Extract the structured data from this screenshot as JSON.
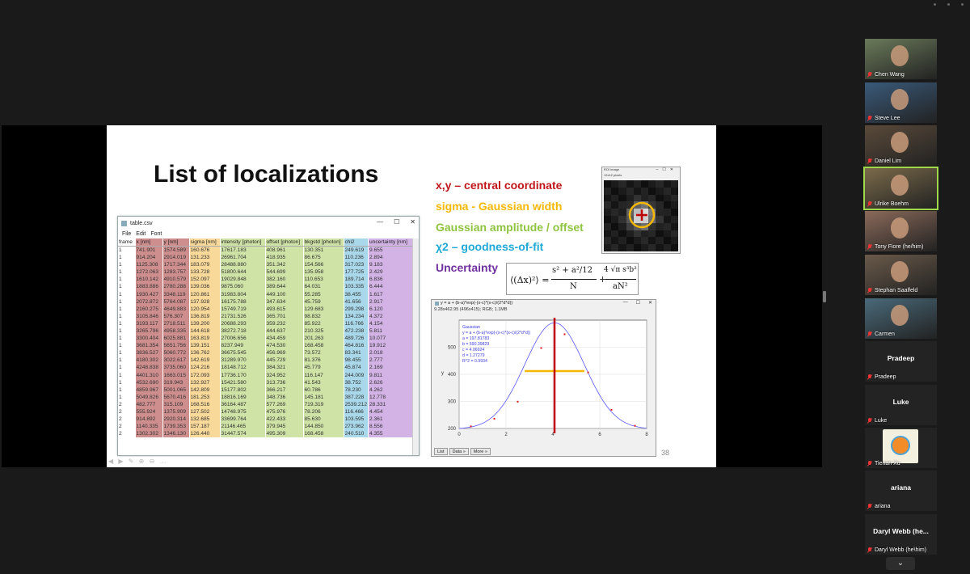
{
  "slide": {
    "title": "List of localizations",
    "legend": [
      {
        "text": "x,y – central coordinate",
        "color": "#c0161b"
      },
      {
        "text": "sigma - Gaussian width",
        "color": "#f5b800"
      },
      {
        "text": "Gaussian amplitude / offset",
        "color": "#8fc440"
      },
      {
        "text": "χ2 – goodness-of-fit",
        "color": "#1fa9d6"
      },
      {
        "text": "Uncertainty",
        "color": "#7030a0"
      }
    ],
    "formula": {
      "lhs": "⟨(Δx)²⟩ =",
      "frac1_num": "s² + a²/12",
      "frac1_den": "N",
      "plus": "+",
      "frac2_num": "4 √π s³b²",
      "frac2_den": "aN²"
    },
    "slide_number": "38"
  },
  "table_window": {
    "title": "table.csv",
    "menu": [
      "File",
      "Edit",
      "Font"
    ],
    "columns": [
      {
        "label": "frame",
        "color": "#ffffff"
      },
      {
        "label": "x [nm]",
        "color": "#ce8e8e"
      },
      {
        "label": "y [nm]",
        "color": "#ce8e8e"
      },
      {
        "label": "sigma [nm]",
        "color": "#f8d99a"
      },
      {
        "label": "intensity [photon]",
        "color": "#cfe3a6"
      },
      {
        "label": "offset [photon]",
        "color": "#cfe3a6"
      },
      {
        "label": "bkgstd [photon]",
        "color": "#cfe3a6"
      },
      {
        "label": "chi2",
        "color": "#a8d8ea"
      },
      {
        "label": "uncertainty [nm]",
        "color": "#d3b2e6"
      }
    ],
    "rows": [
      [
        "1",
        "741.901",
        "1574.589",
        "160.676",
        "17617.183",
        "408.961",
        "130.351",
        "249.619",
        "9.655"
      ],
      [
        "1",
        "914.204",
        "2914.019",
        "131.233",
        "26961.704",
        "418.935",
        "86.675",
        "110.236",
        "2.894"
      ],
      [
        "1",
        "1125.308",
        "1717.344",
        "183.079",
        "28488.880",
        "351.342",
        "154.566",
        "317.023",
        "9.183"
      ],
      [
        "1",
        "1272.063",
        "1283.757",
        "133.728",
        "51800.644",
        "544.699",
        "135.958",
        "177.725",
        "2.429"
      ],
      [
        "1",
        "1610.142",
        "4910.579",
        "152.097",
        "19029.848",
        "382.160",
        "110.653",
        "189.714",
        "6.836"
      ],
      [
        "1",
        "1883.886",
        "2780.288",
        "139.036",
        "9875.060",
        "389.644",
        "64.031",
        "103.335",
        "6.444"
      ],
      [
        "1",
        "1930.427",
        "3348.119",
        "120.861",
        "31983.804",
        "449.100",
        "55.285",
        "38.455",
        "1.617"
      ],
      [
        "1",
        "2072.872",
        "5764.087",
        "137.928",
        "16175.788",
        "347.634",
        "45.759",
        "41.656",
        "2.917"
      ],
      [
        "1",
        "2160.275",
        "4649.883",
        "120.954",
        "15749.719",
        "493.615",
        "129.683",
        "299.298",
        "6.120"
      ],
      [
        "1",
        "3105.846",
        "576.307",
        "136.819",
        "21731.526",
        "365.701",
        "98.832",
        "134.234",
        "4.372"
      ],
      [
        "1",
        "3193.117",
        "2718.511",
        "139.200",
        "20688.293",
        "359.232",
        "85.922",
        "116.766",
        "4.154"
      ],
      [
        "1",
        "3265.796",
        "4958.335",
        "144.618",
        "38272.718",
        "444.637",
        "210.325",
        "472.238",
        "5.811"
      ],
      [
        "1",
        "3300.404",
        "6025.881",
        "163.819",
        "27006.656",
        "434.459",
        "201.263",
        "489.726",
        "10.077"
      ],
      [
        "1",
        "3681.354",
        "5651.756",
        "139.151",
        "8237.949",
        "474.530",
        "168.458",
        "464.816",
        "19.912"
      ],
      [
        "1",
        "3836.527",
        "5060.772",
        "136.762",
        "36675.545",
        "456.969",
        "73.572",
        "83.341",
        "2.018"
      ],
      [
        "1",
        "4180.302",
        "3022.617",
        "142.619",
        "31289.970",
        "445.729",
        "81.376",
        "98.455",
        "2.777"
      ],
      [
        "1",
        "4248.838",
        "3735.060",
        "124.216",
        "18148.712",
        "384.321",
        "45.779",
        "45.874",
        "2.169"
      ],
      [
        "1",
        "4401.310",
        "1663.015",
        "172.093",
        "17736.170",
        "324.952",
        "116.147",
        "244.009",
        "9.811"
      ],
      [
        "1",
        "4532.690",
        "319.943",
        "132.927",
        "15421.580",
        "313.736",
        "41.543",
        "38.752",
        "2.626"
      ],
      [
        "1",
        "4859.967",
        "5001.065",
        "142.809",
        "15177.802",
        "366.217",
        "60.786",
        "78.230",
        "4.262"
      ],
      [
        "1",
        "5049.826",
        "5670.416",
        "181.253",
        "18816.169",
        "348.736",
        "145.181",
        "387.228",
        "12.778"
      ],
      [
        "2",
        "482.777",
        "315.109",
        "168.516",
        "36164.487",
        "577.269",
        "719.319",
        "2539.212",
        "28.331"
      ],
      [
        "2",
        "555.924",
        "1375.909",
        "127.502",
        "14748.975",
        "475.976",
        "78.206",
        "116.466",
        "4.454"
      ],
      [
        "2",
        "914.892",
        "2920.314",
        "132.685",
        "33699.764",
        "422.433",
        "85.630",
        "103.595",
        "2.361"
      ],
      [
        "2",
        "1140.335",
        "1739.353",
        "157.187",
        "21146.465",
        "379.945",
        "144.850",
        "273.962",
        "8.556"
      ],
      [
        "2",
        "1302.302",
        "1346.130",
        "126.440",
        "31447.574",
        "495.309",
        "168.458",
        "240.510",
        "4.355"
      ]
    ]
  },
  "roi_window": {
    "title": "ROI image",
    "subtitle": "12x12 pixels"
  },
  "plot_window": {
    "title": "y = a + (b-a)*exp(-(x-c)*(x-c)/(2*d*d))",
    "info": "9.28x462.95  (496x415); RGB; 1.1MB",
    "legend_lines": [
      "Gaussian",
      "y = a + (b-a)*exp(-(x-c)*(x-c)/(2*d*d))",
      "a = 197.81783",
      "b = 590.39829",
      "c = 4.06924",
      "d = 1.27279",
      "R^2 = 0.9934"
    ],
    "buttons": [
      "List",
      "Data »",
      "More »"
    ],
    "chart_data": {
      "type": "scatter",
      "title": "y = a + (b-a)*exp(-(x-c)*(x-c)/(2*d*d))",
      "xlabel": "",
      "ylabel": "y",
      "xlim": [
        0,
        8
      ],
      "ylim": [
        200,
        600
      ],
      "x_ticks": [
        0,
        2,
        4,
        6,
        8
      ],
      "y_ticks": [
        200,
        300,
        400,
        500
      ],
      "points": [
        {
          "x": 0.5,
          "y": 208
        },
        {
          "x": 1.5,
          "y": 236
        },
        {
          "x": 2.5,
          "y": 299
        },
        {
          "x": 3.5,
          "y": 497
        },
        {
          "x": 4.5,
          "y": 548
        },
        {
          "x": 5.5,
          "y": 407
        },
        {
          "x": 6.5,
          "y": 269
        },
        {
          "x": 7.5,
          "y": 210
        }
      ],
      "fit": {
        "a": 197.81783,
        "b": 590.39829,
        "c": 4.06924,
        "d": 1.27279
      },
      "colors": {
        "points": "#e01818",
        "fit": "#5a5aff",
        "center_line": "#c00000",
        "width_line": "#f5b800"
      }
    }
  },
  "participants": [
    {
      "name": "Chen Wang",
      "type": "video",
      "bg": "#6a7a5a"
    },
    {
      "name": "Steve Lee",
      "type": "video",
      "bg": "#3a5a7a"
    },
    {
      "name": "Daniel Lim",
      "type": "video",
      "bg": "#5a4a3a"
    },
    {
      "name": "Ulrike Boehm",
      "type": "video",
      "bg": "#7a6a4a",
      "active": true
    },
    {
      "name": "Tony Fiore (he/him)",
      "type": "video",
      "bg": "#8a6a5a"
    },
    {
      "name": "Stephan Saalfeld",
      "type": "video",
      "bg": "#6a5a4a"
    },
    {
      "name": "Carmen",
      "type": "video",
      "bg": "#4a6a7a"
    },
    {
      "name": "Pradeep",
      "type": "name",
      "display": "Pradeep"
    },
    {
      "name": "Luke",
      "type": "name",
      "display": "Luke"
    },
    {
      "name": "Tienan Xu",
      "type": "avatar",
      "bg": "#f4f0e0"
    },
    {
      "name": "ariana",
      "type": "name",
      "display": "ariana"
    },
    {
      "name": "Daryl Webb (he\\him)",
      "type": "name",
      "display": "Daryl Webb (he..."
    }
  ]
}
